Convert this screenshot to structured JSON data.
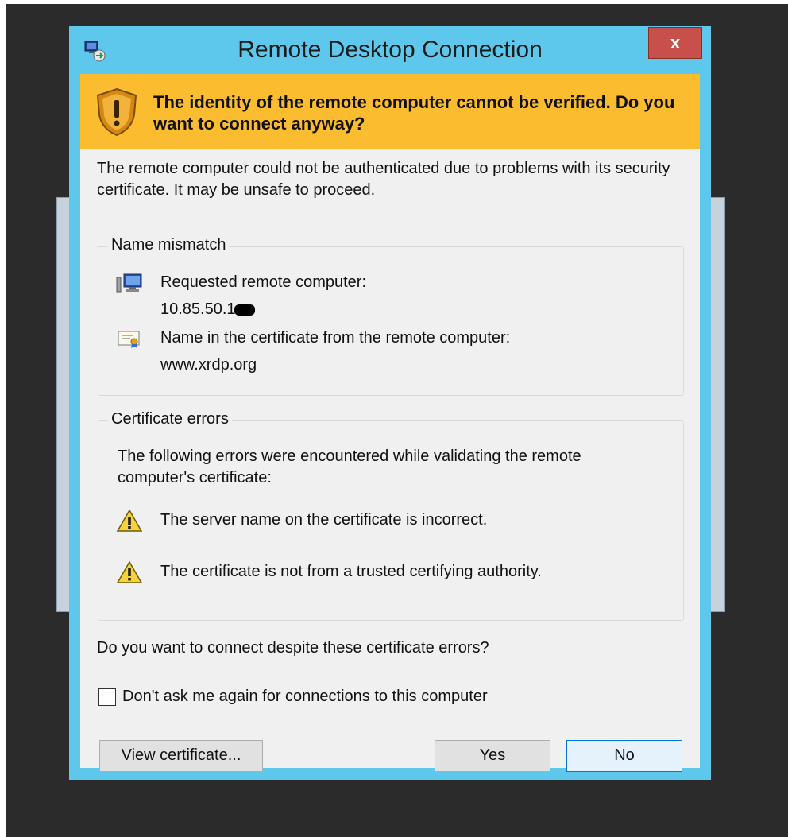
{
  "window": {
    "title": "Remote Desktop Connection",
    "close_label": "x"
  },
  "banner": {
    "text": "The identity of the remote computer cannot be verified. Do you want to connect anyway?"
  },
  "intro": "The remote computer could not be authenticated due to problems with its security certificate. It may be unsafe to proceed.",
  "name_mismatch": {
    "title": "Name mismatch",
    "requested_label": "Requested remote computer:",
    "requested_value": "10.85.50.1",
    "cert_name_label": "Name in the certificate from the remote computer:",
    "cert_name_value": "www.xrdp.org"
  },
  "certificate_errors": {
    "title": "Certificate errors",
    "description": "The following errors were encountered while validating the remote computer's certificate:",
    "errors": [
      "The server name on the certificate is incorrect.",
      "The certificate is not from a trusted certifying authority."
    ]
  },
  "question": "Do you want to connect despite these certificate errors?",
  "dont_ask": {
    "label": "Don't ask me again for connections to this computer",
    "checked": false
  },
  "buttons": {
    "view_certificate": "View certificate...",
    "yes": "Yes",
    "no": "No"
  },
  "icons": {
    "app": "remote-desktop-icon",
    "banner": "warning-shield-icon",
    "computer": "computer-icon",
    "certificate": "certificate-icon",
    "error": "warning-triangle-icon"
  },
  "colors": {
    "window_frame": "#5ec8ec",
    "banner": "#fbbd2f",
    "close_button": "#c7504b",
    "default_button_border": "#0078d7"
  }
}
